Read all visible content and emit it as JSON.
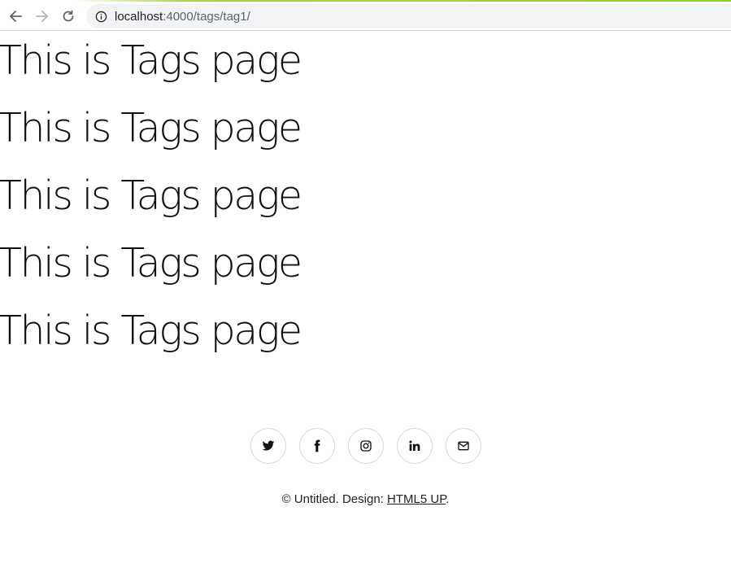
{
  "browser": {
    "url_host": "localhost",
    "url_path": ":4000/tags/tag1/"
  },
  "headings": [
    "This is Tags page",
    "This is Tags page",
    "This is Tags page",
    "This is Tags page",
    "This is Tags page"
  ],
  "social": [
    {
      "name": "twitter-icon"
    },
    {
      "name": "facebook-icon"
    },
    {
      "name": "instagram-icon"
    },
    {
      "name": "linkedin-icon"
    },
    {
      "name": "envelope-icon"
    }
  ],
  "footer": {
    "prefix": "© Untitled. Design: ",
    "link": "HTML5 UP",
    "suffix": "."
  }
}
